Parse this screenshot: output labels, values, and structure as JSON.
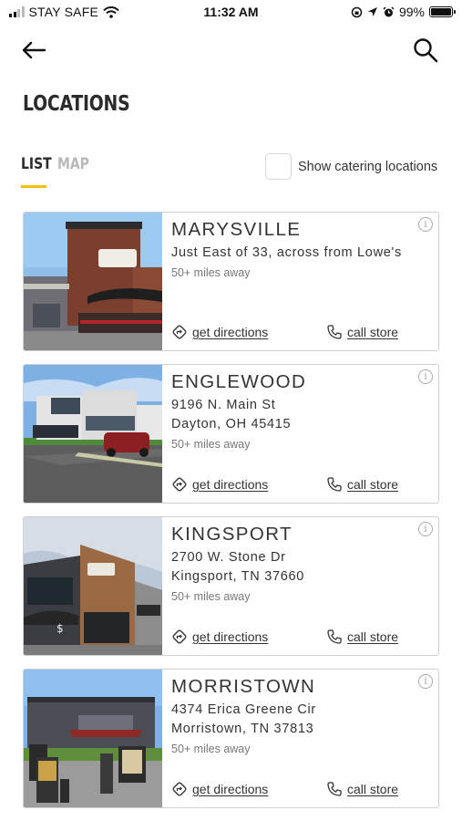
{
  "status_bar": {
    "carrier": "STAY SAFE",
    "time": "11:32 AM",
    "battery": "99%",
    "battery_level": 0.99
  },
  "header": {
    "back_icon": "arrow-left-icon",
    "search_icon": "search-icon",
    "title": "LOCATIONS"
  },
  "tabs": {
    "list": "LIST",
    "map": "MAP",
    "active": "LIST"
  },
  "filter": {
    "catering_label": "Show catering locations",
    "catering_checked": false
  },
  "colors": {
    "accent": "#f2c200",
    "inactive_tab": "#b8b8b8",
    "card_border": "#cfcfcf"
  },
  "locations": [
    {
      "name": "MARYSVILLE",
      "address_line1": "Just East of 33, across from Lowe's",
      "address_line2": "",
      "distance": "50+ miles away",
      "directions_label": "get directions",
      "call_label": "call store"
    },
    {
      "name": "ENGLEWOOD",
      "address_line1": "9196 N. Main St",
      "address_line2": "Dayton, OH 45415",
      "distance": "50+ miles away",
      "directions_label": "get directions",
      "call_label": "call store"
    },
    {
      "name": "KINGSPORT",
      "address_line1": "2700 W. Stone Dr",
      "address_line2": "Kingsport, TN 37660",
      "distance": "50+ miles away",
      "directions_label": "get directions",
      "call_label": "call store"
    },
    {
      "name": "MORRISTOWN",
      "address_line1": "4374 Erica Greene Cir",
      "address_line2": "Morristown, TN 37813",
      "distance": "50+ miles away",
      "directions_label": "get directions",
      "call_label": "call store"
    }
  ]
}
